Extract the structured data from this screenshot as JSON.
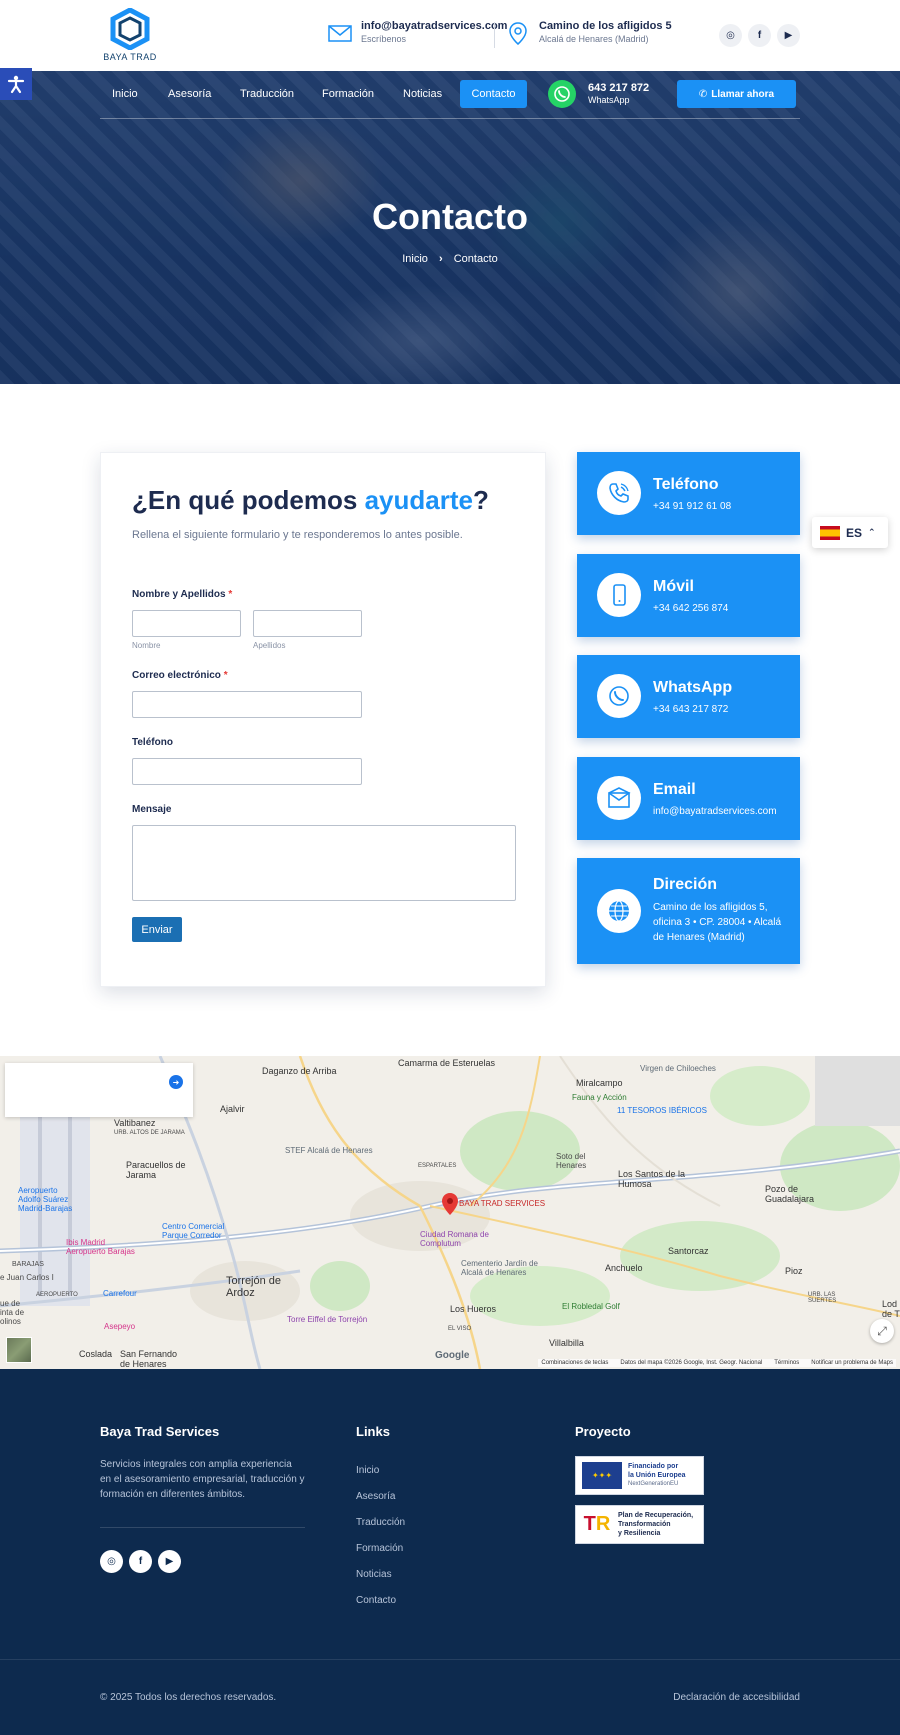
{
  "header": {
    "logo_text": "BAYA TRAD",
    "email": {
      "title": "info@bayatradservices.com",
      "sub": "Escríbenos"
    },
    "address": {
      "title": "Camino de los afligidos 5",
      "sub": "Alcalá de Henares (Madrid)"
    },
    "social": [
      {
        "name": "instagram",
        "glyph": "◎"
      },
      {
        "name": "facebook",
        "glyph": "f"
      },
      {
        "name": "youtube",
        "glyph": "▶"
      }
    ]
  },
  "nav": {
    "items": [
      "Inicio",
      "Asesoría",
      "Traducción",
      "Formación",
      "Noticias"
    ],
    "active": "Contacto",
    "whatsapp_number": "643 217 872",
    "whatsapp_label": "WhatsApp",
    "call_label": "Llamar ahora"
  },
  "hero": {
    "title": "Contacto",
    "breadcrumb_home": "Inicio",
    "breadcrumb_current": "Contacto"
  },
  "form": {
    "title_start": "¿En qué podemos ",
    "title_accent": "ayudarte",
    "title_end": "?",
    "subtitle": "Rellena el siguiente formulario y te responderemos lo antes posible.",
    "name_label": "Nombre y Apellidos",
    "first_hint": "Nombre",
    "last_hint": "Apellidos",
    "email_label": "Correo electrónico",
    "phone_label": "Teléfono",
    "message_label": "Mensaje",
    "required_mark": "*",
    "submit_label": "Enviar"
  },
  "info_cards": [
    {
      "title": "Teléfono",
      "value": "+34 91 912 61 08",
      "icon": "phone-icon"
    },
    {
      "title": "Móvil",
      "value": "+34 642 256 874",
      "icon": "mobile-icon"
    },
    {
      "title": "WhatsApp",
      "value": "+34 643 217 872",
      "icon": "whatsapp-icon"
    },
    {
      "title": "Email",
      "value": "info@bayatradservices.com",
      "icon": "email-icon"
    },
    {
      "title": "Direción",
      "value": "Camino de los afligidos 5, oficina 3 • CP. 28004 • Alcalá de Henares (Madrid)",
      "icon": "globe-icon"
    }
  ],
  "language": {
    "code": "ES"
  },
  "map": {
    "labels": {
      "daganzo": "Daganzo de Arriba",
      "camarma": "Camarma de Esteruelas",
      "virgen": "Virgen de Chiloeches",
      "miralcampo": "Miralcampo",
      "fauna": "Fauna y Acción",
      "tesoros": "11 TESOROS IBÉRICOS",
      "valtibanez": "Valtibanez",
      "altos": "URB. ALTOS DE JARAMA",
      "ajalvir": "Ajalvir",
      "stef": "STEF Alcalá de Henares",
      "paracuellos": "Paracuellos de Jarama",
      "espartales": "ESPARTALES",
      "soto": "Soto del Henares",
      "santos": "Los Santos de la Humosa",
      "pozo": "Pozo de Guadalajara",
      "aeropuerto": "Aeropuerto Adolfo Suárez Madrid-Barajas",
      "centro": "Centro Comercial Parque Corredor",
      "baya": "BAYA TRAD SERVICES",
      "ibis": "Ibis Madrid Aeropuerto Barajas",
      "ciudad": "Ciudad Romana de Complutum",
      "santorcaz": "Santorcaz",
      "barajas": "BARAJAS",
      "juan": "e Juan Carlos I",
      "cementerio": "Cementerio Jardín de Alcalá de Henares",
      "anchuelo": "Anchuelo",
      "piozo": "Pioz",
      "torrejon": "Torrejón de Ardoz",
      "carrefour": "Carrefour",
      "aerop2": "AEROPUERTO",
      "robledal": "El Robledal Golf",
      "urb": "URB. LAS SUERTES",
      "quinta": "ue de inta de olinos",
      "eiffel": "Torre Eiffel de Torrejón",
      "hueros": "Los Hueros",
      "elviso": "EL VISO",
      "asepeyo": "Asepeyo",
      "coslada": "Coslada",
      "fernando": "San Fernando de Henares",
      "villalbilla": "Villalbilla",
      "lod": "Lod de T"
    },
    "footer_keys": "Combinaciones de teclas",
    "footer_data": "Datos del mapa ©2026 Google, Inst. Geogr. Nacional",
    "footer_terms": "Términos",
    "footer_report": "Notificar un problema de Maps",
    "google": "Google"
  },
  "footer": {
    "company_title": "Baya Trad Services",
    "company_desc": "Servicios integrales con amplia experiencia en el asesoramiento empresarial, traducción y formación en diferentes ámbitos.",
    "links_title": "Links",
    "links": [
      "Inicio",
      "Asesoría",
      "Traducción",
      "Formación",
      "Noticias",
      "Contacto"
    ],
    "project_title": "Proyecto",
    "badge1_line1": "Financiado por",
    "badge1_line2": "la Unión Europea",
    "badge1_line3": "NextGenerationEU",
    "badge2_line1": "Plan de Recuperación,",
    "badge2_line2": "Transformación",
    "badge2_line3": "y Resiliencia",
    "copyright": "© 2025 Todos los derechos reservados.",
    "accessibility": "Declaración de accesibilidad"
  }
}
